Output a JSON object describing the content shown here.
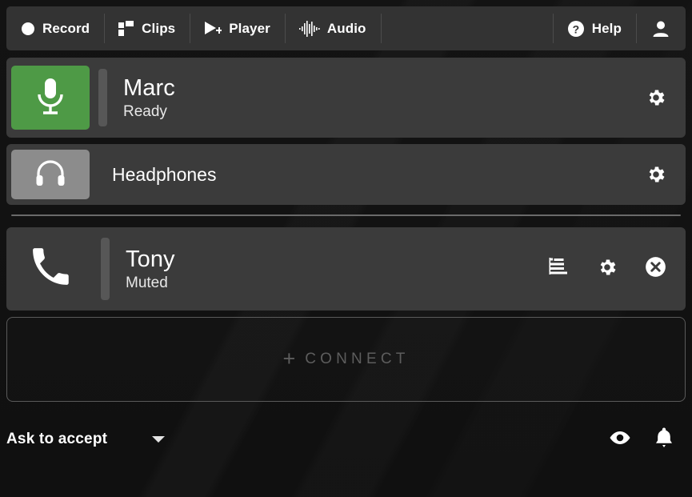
{
  "toolbar": {
    "items": [
      {
        "label": "Record",
        "icon": "record-dot-icon"
      },
      {
        "label": "Clips",
        "icon": "clips-squares-icon"
      },
      {
        "label": "Player",
        "icon": "player-play-plus-icon"
      },
      {
        "label": "Audio",
        "icon": "audio-waveform-icon"
      }
    ],
    "help_label": "Help",
    "help_icon": "help-question-circle-icon",
    "account_icon": "user-avatar-icon"
  },
  "devices": [
    {
      "name": "Marc",
      "status": "Ready",
      "button_icon": "microphone-icon",
      "button_color": "#4e9a46",
      "settings_icon": "gear-icon",
      "has_meter": true
    },
    {
      "name": "Headphones",
      "status": "",
      "button_icon": "headphones-icon",
      "button_color": "#8c8c8c",
      "settings_icon": "gear-icon",
      "has_meter": false
    }
  ],
  "calls": [
    {
      "name": "Tony",
      "status": "Muted",
      "icon": "phone-handset-icon",
      "actions": [
        {
          "icon": "notes-lines-icon",
          "name": "notes-button"
        },
        {
          "icon": "gear-icon",
          "name": "call-settings-button"
        },
        {
          "icon": "close-circle-icon",
          "name": "hangup-button"
        }
      ]
    }
  ],
  "connect": {
    "plus": "+",
    "label": "CONNECT"
  },
  "footer": {
    "accept_mode": "Ask to accept",
    "caret_icon": "chevron-down-icon",
    "icons": [
      {
        "icon": "eye-icon",
        "name": "preview-toggle"
      },
      {
        "icon": "bell-icon",
        "name": "notifications-toggle"
      }
    ]
  },
  "colors": {
    "background": "#121212",
    "panel": "#333333",
    "row": "#3b3b3b",
    "accent_green": "#4e9a46",
    "muted_gray": "#8c8c8c",
    "meter_track": "#575757",
    "connect_text": "#5d5d5d"
  }
}
